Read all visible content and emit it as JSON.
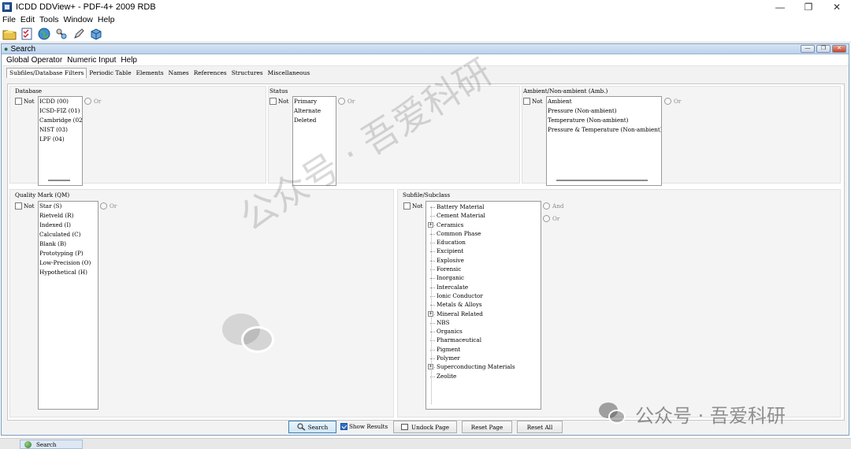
{
  "app": {
    "title": "ICDD DDView+ - PDF-4+ 2009 RDB",
    "menu": [
      "File",
      "Edit",
      "Tools",
      "Window",
      "Help"
    ],
    "toolbar_icons": [
      "folder-icon",
      "checklist-icon",
      "globe-icon",
      "molecule-icon",
      "pen-icon",
      "box-icon"
    ]
  },
  "search_window": {
    "title": "Search",
    "menu": [
      "Global Operator",
      "Numeric Input",
      "Help"
    ],
    "tabs": [
      "Subfiles/Database Filters",
      "Periodic Table",
      "Elements",
      "Names",
      "References",
      "Structures",
      "Miscellaneous"
    ],
    "active_tab": "Subfiles/Database Filters"
  },
  "groups": {
    "database": {
      "title": "Database",
      "not_label": "Not",
      "radio_label": "Or",
      "items": [
        "ICDD (00)",
        "ICSD-FIZ (01)",
        "Cambridge (02)",
        "NIST (03)",
        "LPF (04)"
      ]
    },
    "status": {
      "title": "Status",
      "not_label": "Not",
      "radio_label": "Or",
      "items": [
        "Primary",
        "Alternate",
        "Deleted"
      ]
    },
    "ambient": {
      "title": "Ambient/Non-ambient (Amb.)",
      "not_label": "Not",
      "radio_label": "Or",
      "items": [
        "Ambient",
        "Pressure (Non-ambient)",
        "Temperature (Non-ambient)",
        "Pressure & Temperature (Non-ambient)"
      ]
    },
    "quality": {
      "title": "Quality Mark (QM)",
      "not_label": "Not",
      "radio_label": "Or",
      "items": [
        "Star (S)",
        "Rietveld (R)",
        "Indexed (I)",
        "Calculated (C)",
        "Blank (B)",
        "Prototyping (P)",
        "Low-Precision (O)",
        "Hypothetical (H)"
      ]
    },
    "subfile": {
      "title": "Subfile/Subclass",
      "not_label": "Not",
      "radio_and": "And",
      "radio_or": "Or",
      "items": [
        {
          "label": "Battery Material",
          "expandable": false
        },
        {
          "label": "Cement Material",
          "expandable": false
        },
        {
          "label": "Ceramics",
          "expandable": true
        },
        {
          "label": "Common Phase",
          "expandable": false
        },
        {
          "label": "Education",
          "expandable": false
        },
        {
          "label": "Excipient",
          "expandable": false
        },
        {
          "label": "Explosive",
          "expandable": false
        },
        {
          "label": "Forensic",
          "expandable": false
        },
        {
          "label": "Inorganic",
          "expandable": false
        },
        {
          "label": "Intercalate",
          "expandable": false
        },
        {
          "label": "Ionic Conductor",
          "expandable": false
        },
        {
          "label": "Metals & Alloys",
          "expandable": false
        },
        {
          "label": "Mineral Related",
          "expandable": true
        },
        {
          "label": "NBS",
          "expandable": false
        },
        {
          "label": "Organics",
          "expandable": false
        },
        {
          "label": "Pharmaceutical",
          "expandable": false
        },
        {
          "label": "Pigment",
          "expandable": false
        },
        {
          "label": "Polymer",
          "expandable": false
        },
        {
          "label": "Superconducting Materials",
          "expandable": true
        },
        {
          "label": "Zeolite",
          "expandable": false
        }
      ]
    }
  },
  "buttons": {
    "search": "Search",
    "show_results": "Show Results",
    "show_results_checked": true,
    "undock": "Undock Page",
    "reset_page": "Reset Page",
    "reset_all": "Reset All"
  },
  "taskbar": {
    "item": "Search"
  },
  "watermark": {
    "big": "公众号 · 吾爱科研",
    "small": "公众号 · 吾爱科研"
  }
}
